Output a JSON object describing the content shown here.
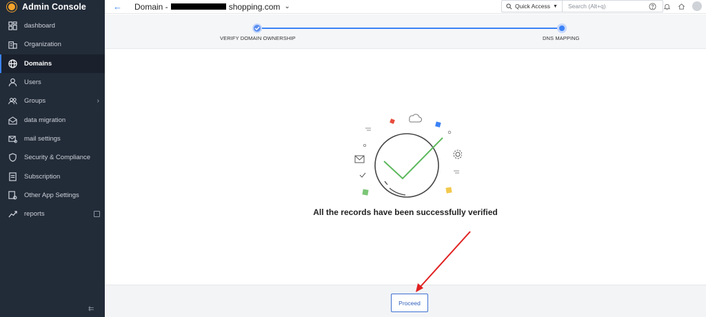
{
  "app": {
    "title": "Admin Console"
  },
  "sidebar": {
    "items": [
      {
        "label": "dashboard",
        "icon": "dashboard-icon"
      },
      {
        "label": "Organization",
        "icon": "organization-icon"
      },
      {
        "label": "Domains",
        "icon": "globe-icon",
        "active": true
      },
      {
        "label": "Users",
        "icon": "user-icon"
      },
      {
        "label": "Groups",
        "icon": "groups-icon",
        "chevron": "›"
      },
      {
        "label": "data migration",
        "icon": "migration-icon"
      },
      {
        "label": "mail settings",
        "icon": "mail-settings-icon"
      },
      {
        "label": "Security & Compliance",
        "icon": "shield-icon"
      },
      {
        "label": "Subscription",
        "icon": "subscription-icon"
      },
      {
        "label": "Other App Settings",
        "icon": "app-settings-icon"
      },
      {
        "label": "reports",
        "icon": "reports-icon"
      }
    ],
    "collapse_glyph": "⇇"
  },
  "header": {
    "title_prefix": "Domain - ",
    "title_suffix": "shopping.com",
    "quick_access": "Quick Access",
    "search_placeholder": "Search (Alt+q)"
  },
  "stepper": {
    "steps": [
      {
        "label": "VERIFY DOMAIN OWNERSHIP",
        "status": "completed"
      },
      {
        "label": "DNS MAPPING",
        "status": "current"
      }
    ]
  },
  "main": {
    "message": "All the records have been successfully verified"
  },
  "footer": {
    "proceed_label": "Proceed"
  },
  "colors": {
    "sidebar_bg": "#222b38",
    "accent": "#3b82f6",
    "success": "#5cb85c",
    "annotation": "#e02020"
  }
}
